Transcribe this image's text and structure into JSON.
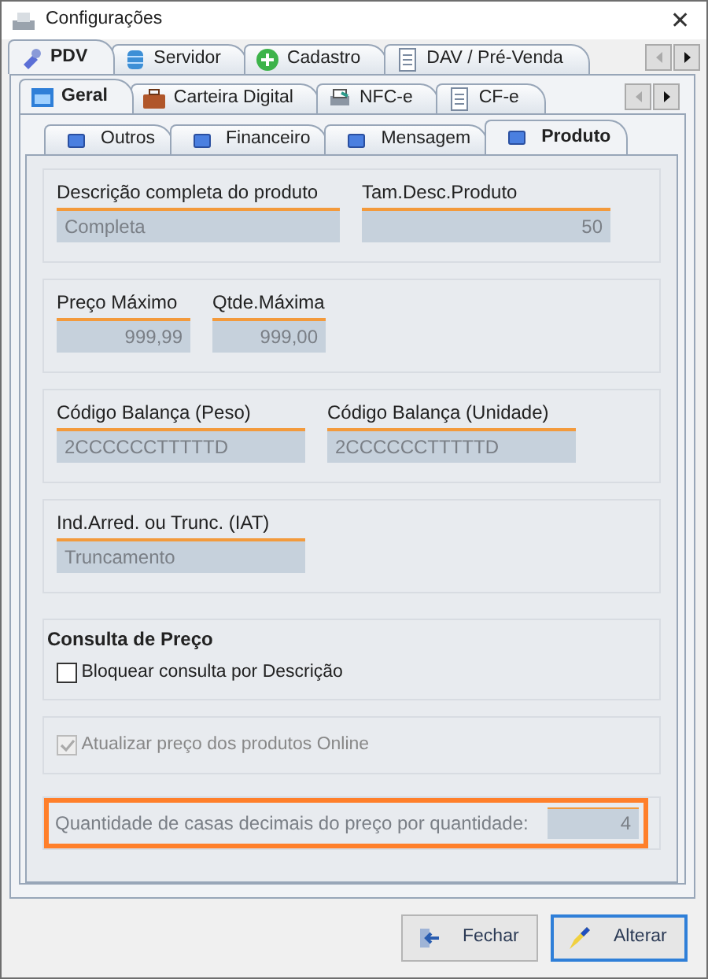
{
  "window": {
    "title": "Configurações",
    "close": "✕"
  },
  "main_tabs": [
    {
      "label": "PDV",
      "selected": true
    },
    {
      "label": "Servidor",
      "selected": false
    },
    {
      "label": "Cadastro",
      "selected": false
    },
    {
      "label": "DAV / Pré-Venda",
      "selected": false
    }
  ],
  "sub_tabs": [
    {
      "label": "Geral",
      "selected": true
    },
    {
      "label": "Carteira Digital",
      "selected": false
    },
    {
      "label": "NFC-e",
      "selected": false
    },
    {
      "label": "CF-e",
      "selected": false
    }
  ],
  "section_tabs": [
    {
      "label": "Outros",
      "selected": false
    },
    {
      "label": "Financeiro",
      "selected": false
    },
    {
      "label": "Mensagem",
      "selected": false
    },
    {
      "label": "Produto",
      "selected": true
    }
  ],
  "groups": [
    {
      "kind": "fields",
      "fields": [
        {
          "label": "Descrição completa do produto",
          "value": "Completa",
          "numeric": false
        },
        {
          "label": "Tam.Desc.Produto",
          "value": "50",
          "numeric": true
        }
      ]
    },
    {
      "kind": "fields",
      "fields": [
        {
          "label": "Preço Máximo",
          "value": "999,99",
          "numeric": true
        },
        {
          "label": "Qtde.Máxima",
          "value": "999,00",
          "numeric": true
        }
      ]
    },
    {
      "kind": "fields",
      "fields": [
        {
          "label": "Código Balança (Peso)",
          "value": "2CCCCCCTTTTTD",
          "numeric": false
        },
        {
          "label": "Código Balança (Unidade)",
          "value": "2CCCCCCTTTTTD",
          "numeric": false
        }
      ]
    },
    {
      "kind": "fields",
      "fields": [
        {
          "label": "Ind.Arred. ou Trunc. (IAT)",
          "value": "Truncamento",
          "numeric": false
        }
      ]
    },
    {
      "kind": "checkbox",
      "title": "Consulta de Preço",
      "label": "Bloquear consulta por Descrição",
      "checked": false,
      "disabled": false
    },
    {
      "kind": "checkbox",
      "label": "Atualizar preço dos produtos Online",
      "checked": true,
      "disabled": true
    },
    {
      "kind": "inline",
      "label": "Quantidade de casas decimais do preço por quantidade:",
      "value": "4",
      "highlighted": true
    }
  ],
  "buttons": [
    {
      "label": "Fechar",
      "focused": false
    },
    {
      "label": "Alterar",
      "focused": true
    }
  ]
}
